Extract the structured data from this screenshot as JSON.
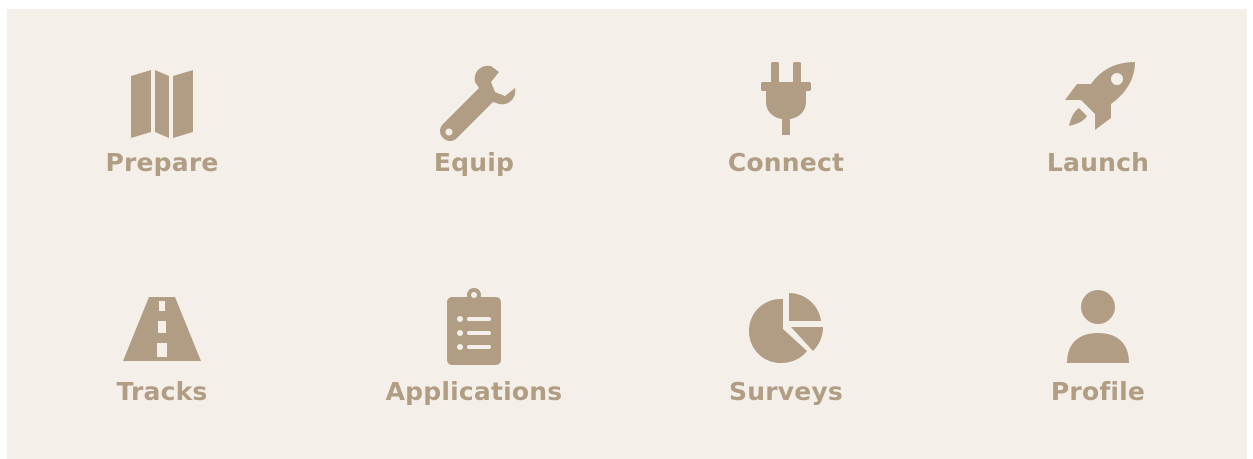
{
  "colors": {
    "background": "#f4efe9",
    "accent": "#b09d83"
  },
  "tiles": [
    {
      "label": "Prepare",
      "icon": "map-icon"
    },
    {
      "label": "Equip",
      "icon": "wrench-icon"
    },
    {
      "label": "Connect",
      "icon": "plug-icon"
    },
    {
      "label": "Launch",
      "icon": "rocket-icon"
    },
    {
      "label": "Tracks",
      "icon": "road-icon"
    },
    {
      "label": "Applications",
      "icon": "clipboard-list-icon"
    },
    {
      "label": "Surveys",
      "icon": "pie-chart-icon"
    },
    {
      "label": "Profile",
      "icon": "user-icon"
    }
  ]
}
